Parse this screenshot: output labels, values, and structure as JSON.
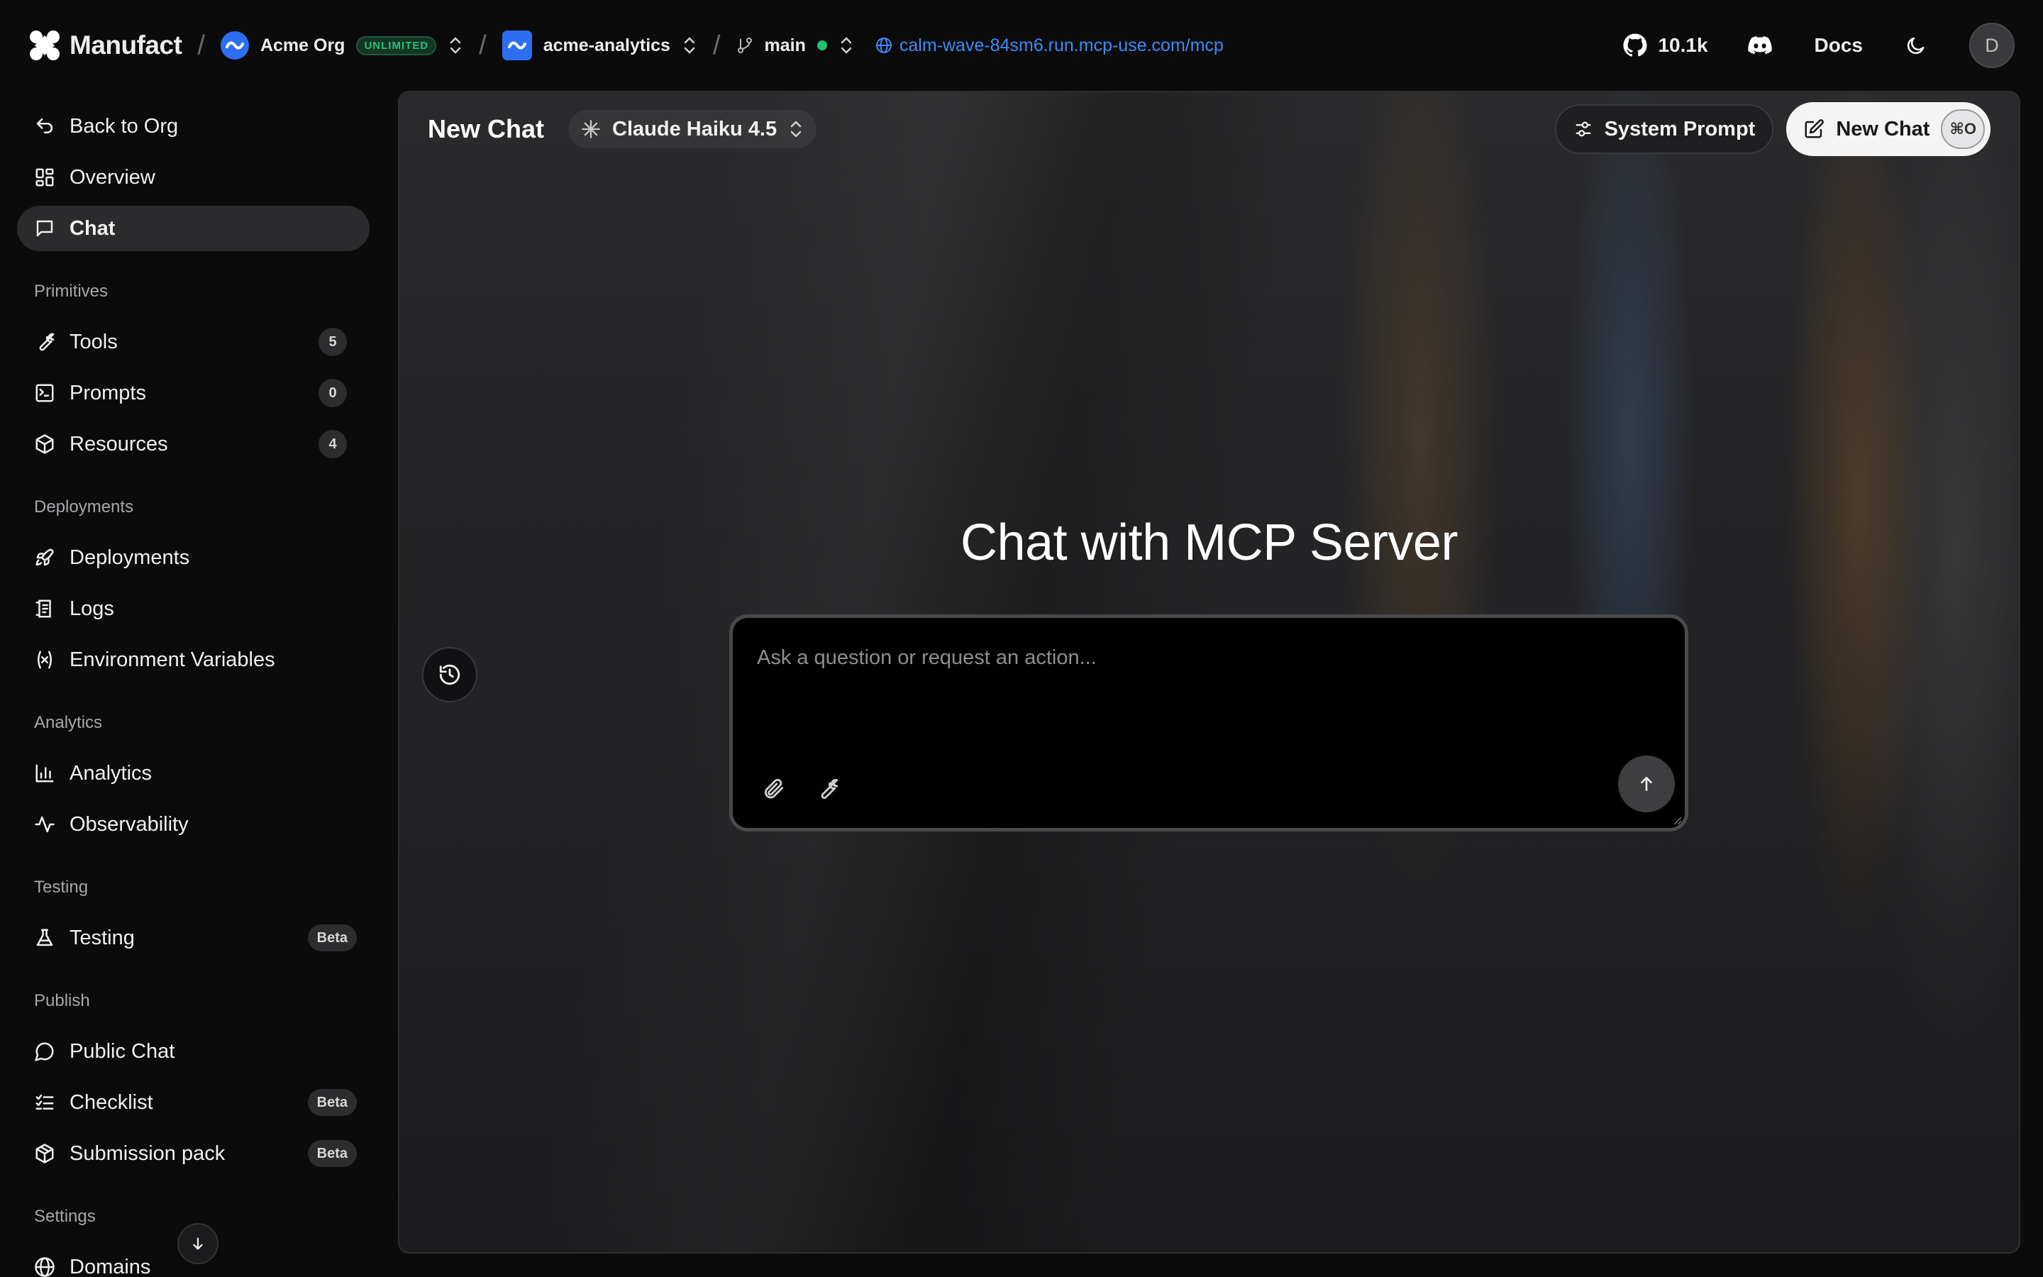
{
  "topbar": {
    "brand": "Manufact",
    "org": {
      "name": "Acme Org",
      "plan_badge": "UNLIMITED"
    },
    "project": {
      "name": "acme-analytics"
    },
    "branch": {
      "name": "main"
    },
    "mcp_url": "calm-wave-84sm6.run.mcp-use.com/mcp",
    "github_stars": "10.1k",
    "docs_label": "Docs",
    "avatar_initial": "D",
    "separator": "/"
  },
  "sidebar": {
    "top_items": [
      {
        "label": "Back to Org",
        "icon": "back-arrow-icon"
      },
      {
        "label": "Overview",
        "icon": "grid-icon"
      },
      {
        "label": "Chat",
        "icon": "chat-icon",
        "active": true
      }
    ],
    "sections": [
      {
        "label": "Primitives",
        "items": [
          {
            "label": "Tools",
            "icon": "wrench-icon",
            "count": "5"
          },
          {
            "label": "Prompts",
            "icon": "terminal-icon",
            "count": "0"
          },
          {
            "label": "Resources",
            "icon": "box-icon",
            "count": "4"
          }
        ]
      },
      {
        "label": "Deployments",
        "items": [
          {
            "label": "Deployments",
            "icon": "rocket-icon"
          },
          {
            "label": "Logs",
            "icon": "logs-icon"
          },
          {
            "label": "Environment Variables",
            "icon": "variable-icon"
          }
        ]
      },
      {
        "label": "Analytics",
        "items": [
          {
            "label": "Analytics",
            "icon": "bar-chart-icon"
          },
          {
            "label": "Observability",
            "icon": "activity-icon"
          }
        ]
      },
      {
        "label": "Testing",
        "items": [
          {
            "label": "Testing",
            "icon": "flask-icon",
            "badge": "Beta"
          }
        ]
      },
      {
        "label": "Publish",
        "items": [
          {
            "label": "Public Chat",
            "icon": "message-circle-icon"
          },
          {
            "label": "Checklist",
            "icon": "checklist-icon",
            "badge": "Beta"
          },
          {
            "label": "Submission pack",
            "icon": "package-icon",
            "badge": "Beta"
          }
        ]
      },
      {
        "label": "Settings",
        "items": [
          {
            "label": "Domains",
            "icon": "globe-icon"
          }
        ]
      }
    ]
  },
  "main": {
    "title": "New Chat",
    "model": "Claude Haiku 4.5",
    "system_prompt_label": "System Prompt",
    "new_chat_label": "New Chat",
    "new_chat_shortcut": "⌘O",
    "hero_title": "Chat with MCP Server",
    "composer_placeholder": "Ask a question or request an action..."
  },
  "colors": {
    "accent_link": "#3b8cf7",
    "status_green": "#23c069",
    "badge_green": "#27c07a",
    "brand_blue": "#2d6ff2"
  }
}
